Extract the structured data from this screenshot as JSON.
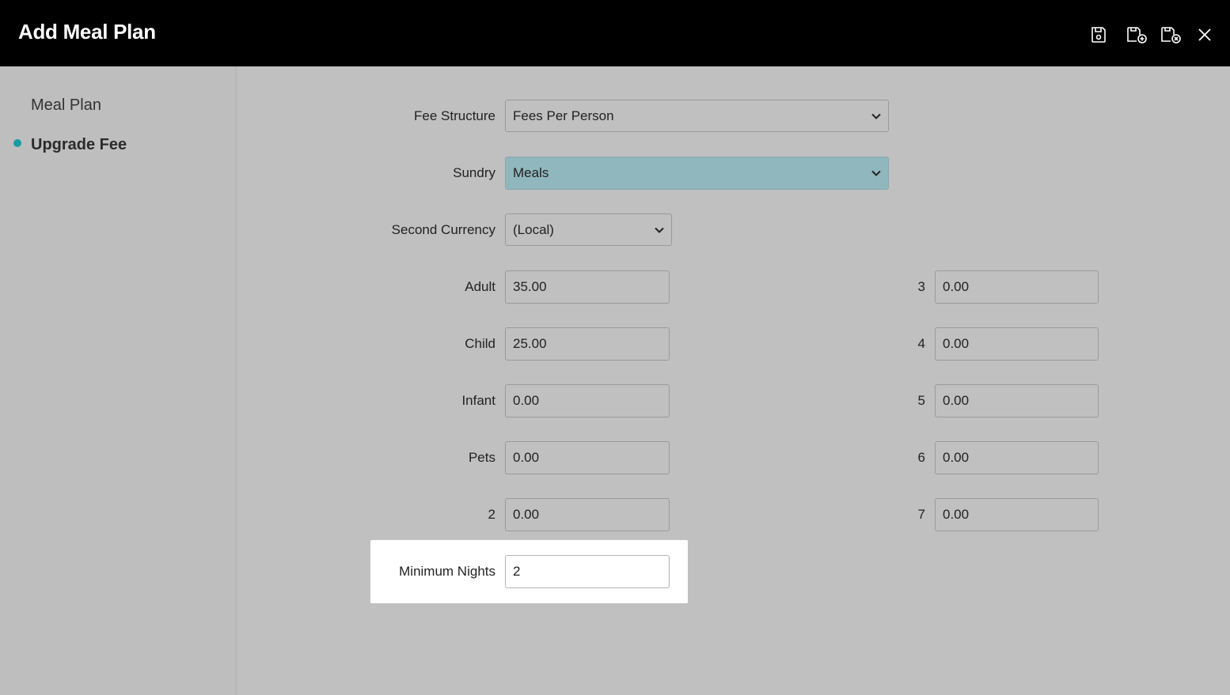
{
  "header": {
    "title": "Add Meal Plan",
    "icons": [
      "save-icon",
      "save-and-new-icon",
      "save-and-close-icon",
      "close-icon"
    ]
  },
  "sidebar": {
    "items": [
      {
        "label": "Meal Plan",
        "active": false
      },
      {
        "label": "Upgrade Fee",
        "active": true
      }
    ],
    "accent": "#1a9ba3"
  },
  "form": {
    "fee_structure": {
      "label": "Fee Structure",
      "value": "Fees Per Person"
    },
    "sundry": {
      "label": "Sundry",
      "value": "Meals",
      "highlight_color": "#8fb7bd"
    },
    "second_currency": {
      "label": "Second Currency",
      "value": "(Local)"
    },
    "left_fees": [
      {
        "label": "Adult",
        "value": "35.00"
      },
      {
        "label": "Child",
        "value": "25.00"
      },
      {
        "label": "Infant",
        "value": "0.00"
      },
      {
        "label": "Pets",
        "value": "0.00"
      },
      {
        "label": "2",
        "value": "0.00"
      }
    ],
    "right_fees": [
      {
        "label": "3",
        "value": "0.00"
      },
      {
        "label": "4",
        "value": "0.00"
      },
      {
        "label": "5",
        "value": "0.00"
      },
      {
        "label": "6",
        "value": "0.00"
      },
      {
        "label": "7",
        "value": "0.00"
      }
    ],
    "minimum_nights": {
      "label": "Minimum Nights",
      "value": "2"
    }
  }
}
